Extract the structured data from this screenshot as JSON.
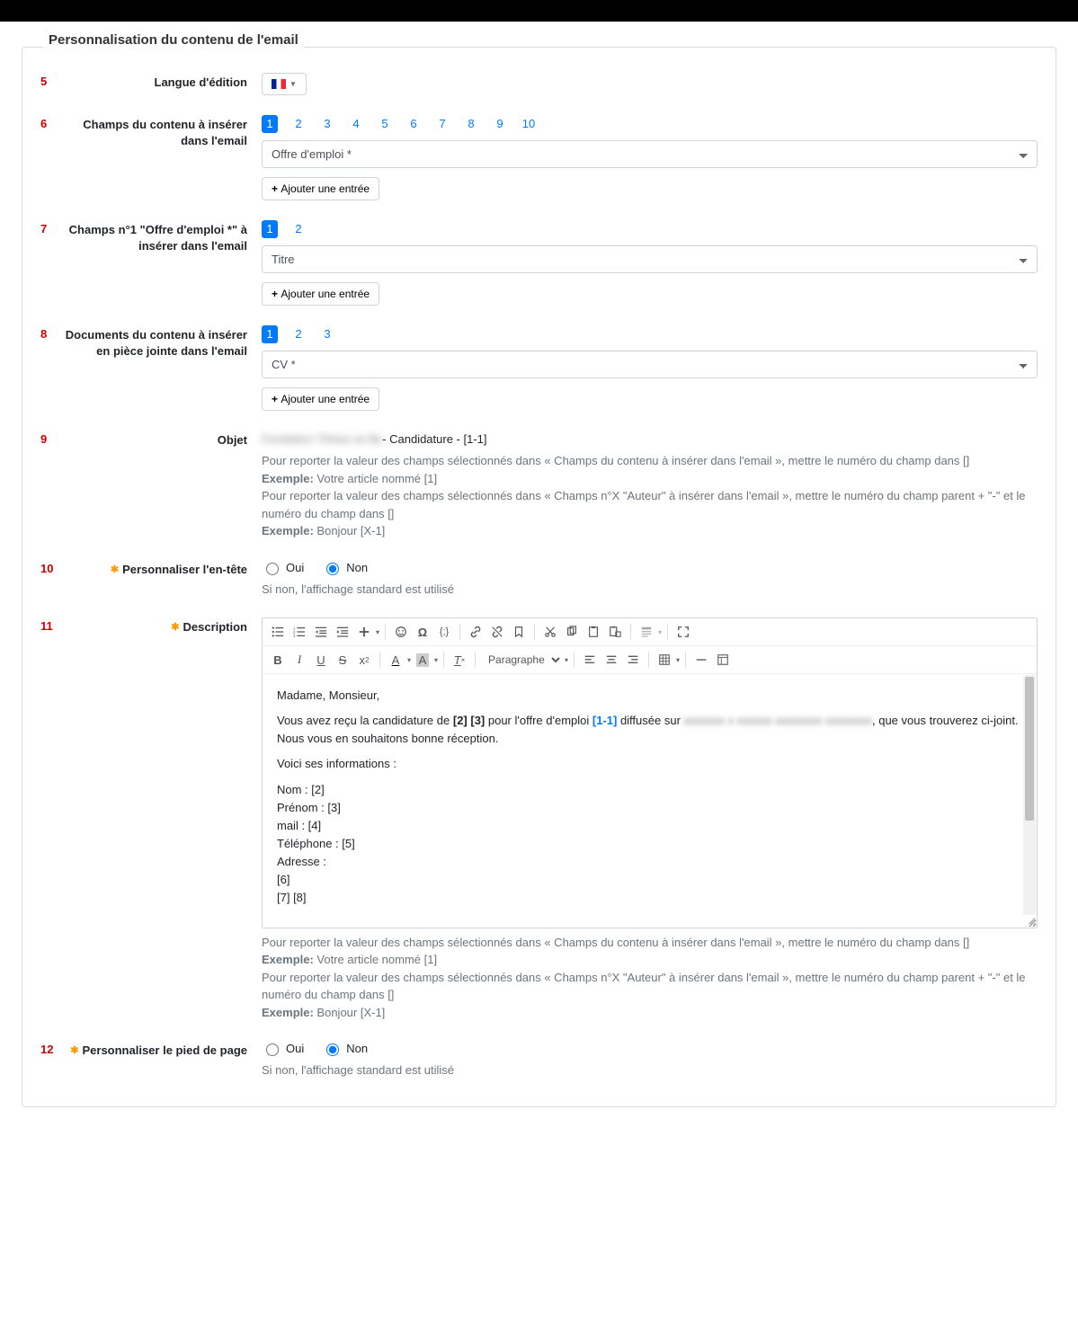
{
  "title": "Personnalisation du contenu de l'email",
  "rows": {
    "r5": {
      "num": "5",
      "label": "Langue d'édition"
    },
    "r6": {
      "num": "6",
      "label": "Champs du contenu à insérer dans l'email",
      "pager": [
        "1",
        "2",
        "3",
        "4",
        "5",
        "6",
        "7",
        "8",
        "9",
        "10"
      ],
      "select": "Offre d'emploi *",
      "add": "Ajouter une entrée"
    },
    "r7": {
      "num": "7",
      "label": "Champs n°1 \"Offre d'emploi *\" à insérer dans l'email",
      "pager": [
        "1",
        "2"
      ],
      "select": "Titre",
      "add": "Ajouter une entrée"
    },
    "r8": {
      "num": "8",
      "label": "Documents du contenu à insérer en pièce jointe dans l'email",
      "pager": [
        "1",
        "2",
        "3"
      ],
      "select": "CV *",
      "add": "Ajouter une entrée"
    },
    "r9": {
      "num": "9",
      "label": "Objet",
      "blur": "Fondation Thiriez et fils",
      "rest": " - Candidature - [1-1]"
    },
    "r10": {
      "num": "10",
      "label": "Personnaliser l'en-tête",
      "oui": "Oui",
      "non": "Non",
      "note": "Si non, l'affichage standard est utilisé"
    },
    "r11": {
      "num": "11",
      "label": "Description"
    },
    "r12": {
      "num": "12",
      "label": "Personnaliser le pied de page",
      "oui": "Oui",
      "non": "Non",
      "note": "Si non, l'affichage standard est utilisé"
    }
  },
  "help": {
    "l1": "Pour reporter la valeur des champs sélectionnés dans « Champs du contenu à insérer dans l'email », mettre le numéro du champ dans []",
    "ex1l": "Exemple:",
    "ex1": " Votre article nommé [1]",
    "l2": "Pour reporter la valeur des champs sélectionnés dans « Champs n°X \"Auteur\" à insérer dans l'email », mettre le numéro du champ parent + \"-\" et le numéro du champ dans []",
    "ex2l": "Exemple:",
    "ex2": " Bonjour [X-1]"
  },
  "editor": {
    "paragraph": "Paragraphe",
    "body": {
      "greet": "Madame, Monsieur,",
      "p2a": "Vous avez reçu la candidature de ",
      "b23": "[2] [3]",
      "p2b": " pour l'offre d'emploi ",
      "link": "[1-1]",
      "p2c": " diffusée sur ",
      "blur": "xxxxxxx x xxxxxx xxxxxxxx xxxxxxxx",
      "p2d": ", que vous trouverez ci-joint.",
      "p3": "Nous vous en souhaitons bonne réception.",
      "p4": "Voici ses informations :",
      "i1": "Nom : [2]",
      "i2": "Prénom : [3]",
      "i3": "mail : [4]",
      "i4": "Téléphone : [5]",
      "i5": "Adresse :",
      "i6": "[6]",
      "i7": "[7] [8]"
    }
  }
}
